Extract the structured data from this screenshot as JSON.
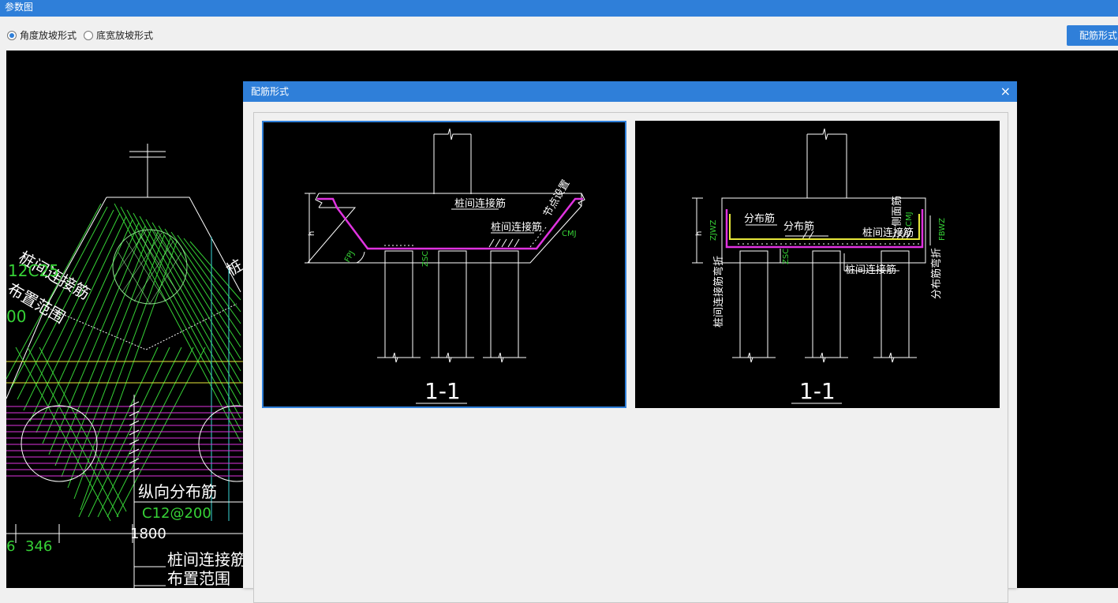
{
  "window": {
    "title": "参数图"
  },
  "slope_options": [
    {
      "label": "角度放坡形式",
      "selected": true
    },
    {
      "label": "底宽放坡形式",
      "selected": false
    }
  ],
  "toolbar": {
    "rebar_style_button": "配筋形式"
  },
  "background_drawing": {
    "texts": {
      "pile_connect_rebar": "桩间连接筋",
      "spec_rebar": "12C25",
      "layout_range": "布置范围",
      "zero": "00",
      "pile_char": "桩",
      "long_dist_rebar": "纵向分布筋",
      "spec_dist": "C12@200",
      "dim_6": "6",
      "dim_346": "346",
      "dim_1800": "1800",
      "pile_connect_rebar2": "桩间连接筋",
      "layout_range2": "布置范围"
    }
  },
  "dialog": {
    "title": "配筋形式",
    "close_symbol": "×",
    "options": [
      {
        "selected": true,
        "section_label": "1-1",
        "labels": {
          "pile_connect": "桩间连接筋",
          "pile_connect2": "桩间连接筋",
          "node_setting": "节点设置",
          "fpj": "FPJ",
          "zsc": "ZSC",
          "cmj": "CMJ",
          "h": "h"
        }
      },
      {
        "selected": false,
        "section_label": "1-1",
        "labels": {
          "dist1": "分布筋",
          "dist2": "分布筋",
          "pile_connect": "桩间连接筋",
          "pile_connect_bottom": "桩间连接筋",
          "side_rebar": "侧面筋",
          "cmj": "CMJ",
          "zjwz": "ZJWZ",
          "fbwz": "FBWZ",
          "zsc": "ZSC",
          "pile_bend": "桩间连接筋弯折",
          "dist_bend": "分布筋弯折",
          "h": "h"
        }
      }
    ]
  }
}
